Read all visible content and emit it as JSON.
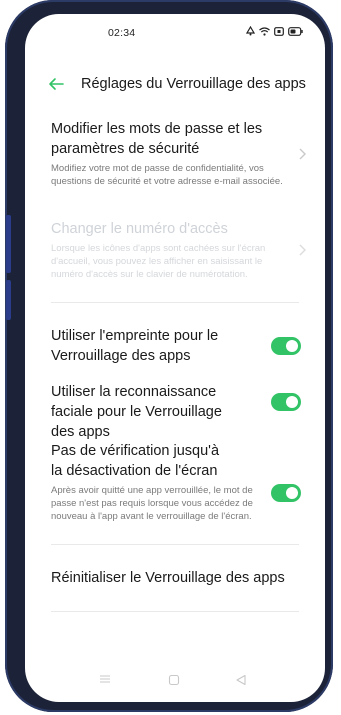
{
  "status": {
    "time": "02:34",
    "icons": [
      "alarm-icon",
      "wifi-icon",
      "nfc-icon",
      "battery-icon"
    ]
  },
  "header": {
    "back_icon": "arrow-left-icon",
    "title": "Réglages du Verrouillage des apps"
  },
  "passwords": {
    "title": "Modifier les mots de passe et les paramètres de sécurité",
    "subtitle": "Modifiez votre mot de passe de confidentialité, vos questions de sécurité et votre adresse e-mail associée."
  },
  "access_number": {
    "title": "Changer le numéro d'accès",
    "subtitle": "Lorsque les icônes d'apps sont cachées sur l'écran d'accueil, vous pouvez les afficher en saisissant le numéro d'accès sur le clavier de numérotation.",
    "enabled": false
  },
  "fingerprint": {
    "title": "Utiliser l'empreinte pour le Verrouillage des apps",
    "on": true
  },
  "face": {
    "title": "Utiliser la reconnaissance faciale pour le Verrouillage des apps",
    "on": true
  },
  "no_verify": {
    "title": "Pas de vérification jusqu'à la désactivation de l'écran",
    "subtitle": "Après avoir quitté une app verrouillée, le mot de passe n'est pas requis lorsque vous accédez de nouveau à l'app avant le verrouillage de l'écran.",
    "on": true
  },
  "reset": {
    "title": "Réinitialiser le Verrouillage des apps"
  },
  "colors": {
    "accent": "#31c366",
    "frame": "#1c2338"
  },
  "navbar": {
    "icons": [
      "menu-icon",
      "home-icon",
      "back-icon"
    ]
  }
}
